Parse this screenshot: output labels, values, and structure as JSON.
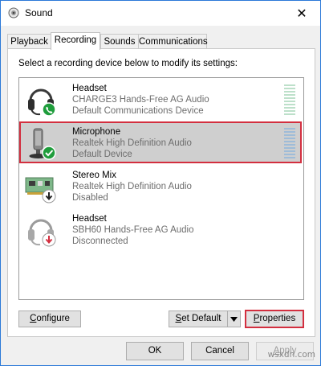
{
  "window": {
    "title": "Sound",
    "close_glyph": "✕"
  },
  "tabs": [
    {
      "label": "Playback",
      "active": false
    },
    {
      "label": "Recording",
      "active": true
    },
    {
      "label": "Sounds",
      "active": false
    },
    {
      "label": "Communications",
      "active": false
    }
  ],
  "instructions": "Select a recording device below to modify its settings:",
  "devices": [
    {
      "name": "Headset",
      "desc": "CHARGE3 Hands-Free AG Audio",
      "status": "Default Communications Device",
      "icon": "headset-icon",
      "badge": "phone-badge-icon",
      "selected": false
    },
    {
      "name": "Microphone",
      "desc": "Realtek High Definition Audio",
      "status": "Default Device",
      "icon": "microphone-icon",
      "badge": "check-badge-icon",
      "selected": true
    },
    {
      "name": "Stereo Mix",
      "desc": "Realtek High Definition Audio",
      "status": "Disabled",
      "icon": "sound-card-icon",
      "badge": "down-arrow-badge-icon",
      "selected": false
    },
    {
      "name": "Headset",
      "desc": "SBH60 Hands-Free AG Audio",
      "status": "Disconnected",
      "icon": "headset-icon",
      "badge": "down-arrow-badge-red-icon",
      "selected": false
    }
  ],
  "buttons": {
    "configure_first": "C",
    "configure_rest": "onfigure",
    "set_default_first": "S",
    "set_default_rest": "et Default",
    "properties_first": "P",
    "properties_rest": "roperties"
  },
  "footer": {
    "ok": "OK",
    "cancel": "Cancel",
    "apply_first": "A",
    "apply_rest": "pply"
  },
  "watermark": "wsxdn.com",
  "colors": {
    "accent": "#2b79d8",
    "highlight": "#d32f3f",
    "green": "#1f9d3c",
    "selected_bg": "#cfcfcf"
  }
}
